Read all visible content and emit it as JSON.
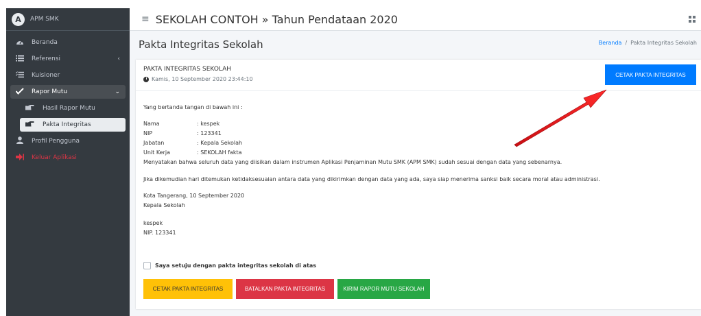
{
  "brand": {
    "name": "APM SMK",
    "logo_letter": "A"
  },
  "sidebar": {
    "items": [
      {
        "label": "Beranda",
        "icon": "dashboard-icon"
      },
      {
        "label": "Referensi",
        "icon": "list-icon"
      },
      {
        "label": "Kuisioner",
        "icon": "checklist-icon"
      },
      {
        "label": "Rapor Mutu",
        "icon": "check-double-icon"
      },
      {
        "label": "Hasil Rapor Mutu",
        "icon": "hand-pointer-icon"
      },
      {
        "label": "Pakta Integritas",
        "icon": "hand-pointer-icon"
      },
      {
        "label": "Profil Pengguna",
        "icon": "user-icon"
      },
      {
        "label": "Keluar Aplikasi",
        "icon": "sign-out-icon"
      }
    ]
  },
  "topbar": {
    "title": "SEKOLAH CONTOH » Tahun Pendataan 2020"
  },
  "page": {
    "title": "Pakta Integritas Sekolah"
  },
  "breadcrumb": {
    "home": "Beranda",
    "separator": "/",
    "current": "Pakta Integritas Sekolah"
  },
  "card": {
    "title": "PAKTA INTEGRITAS SEKOLAH",
    "datetime": "Kamis, 10 September 2020 23:44:10",
    "print_button": "CETAK PAKTA INTEGRITAS"
  },
  "body": {
    "intro": "Yang bertanda tangan di bawah ini :",
    "fields": [
      {
        "key": "Nama",
        "value": ": kespek"
      },
      {
        "key": "NIP",
        "value": ": 123341"
      },
      {
        "key": "Jabatan",
        "value": ": Kepala Sekolah"
      },
      {
        "key": "Unit Kerja",
        "value": ": SEKOLAH fakta"
      }
    ],
    "statement1": "Menyatakan bahwa seluruh data yang diisikan dalam instrumen Aplikasi Penjaminan Mutu SMK (APM SMK) sudah sesuai dengan data yang sebenarnya.",
    "statement2": "Jika dikemudian hari ditemukan ketidaksesuaian antara data yang dikirimkan dengan data yang ada, saya siap menerima sanksi baik secara moral atau administrasi.",
    "place_date": "Kota Tangerang, 10 September 2020",
    "position": "Kepala Sekolah",
    "signer": "kespek",
    "signer_nip": "NIP. 123341"
  },
  "agree_label": "Saya setuju dengan pakta integritas sekolah di atas",
  "buttons": {
    "print": "CETAK PAKTA INTEGRITAS",
    "cancel": "BATALKAN PAKTA INTEGRITAS",
    "send": "KIRIM RAPOR MUTU SEKOLAH"
  },
  "colors": {
    "sidebar": "#343a40",
    "primary": "#007bff",
    "warning": "#ffc107",
    "danger": "#dc3545",
    "success": "#28a745",
    "annotation_arrow": "#e0161b"
  }
}
